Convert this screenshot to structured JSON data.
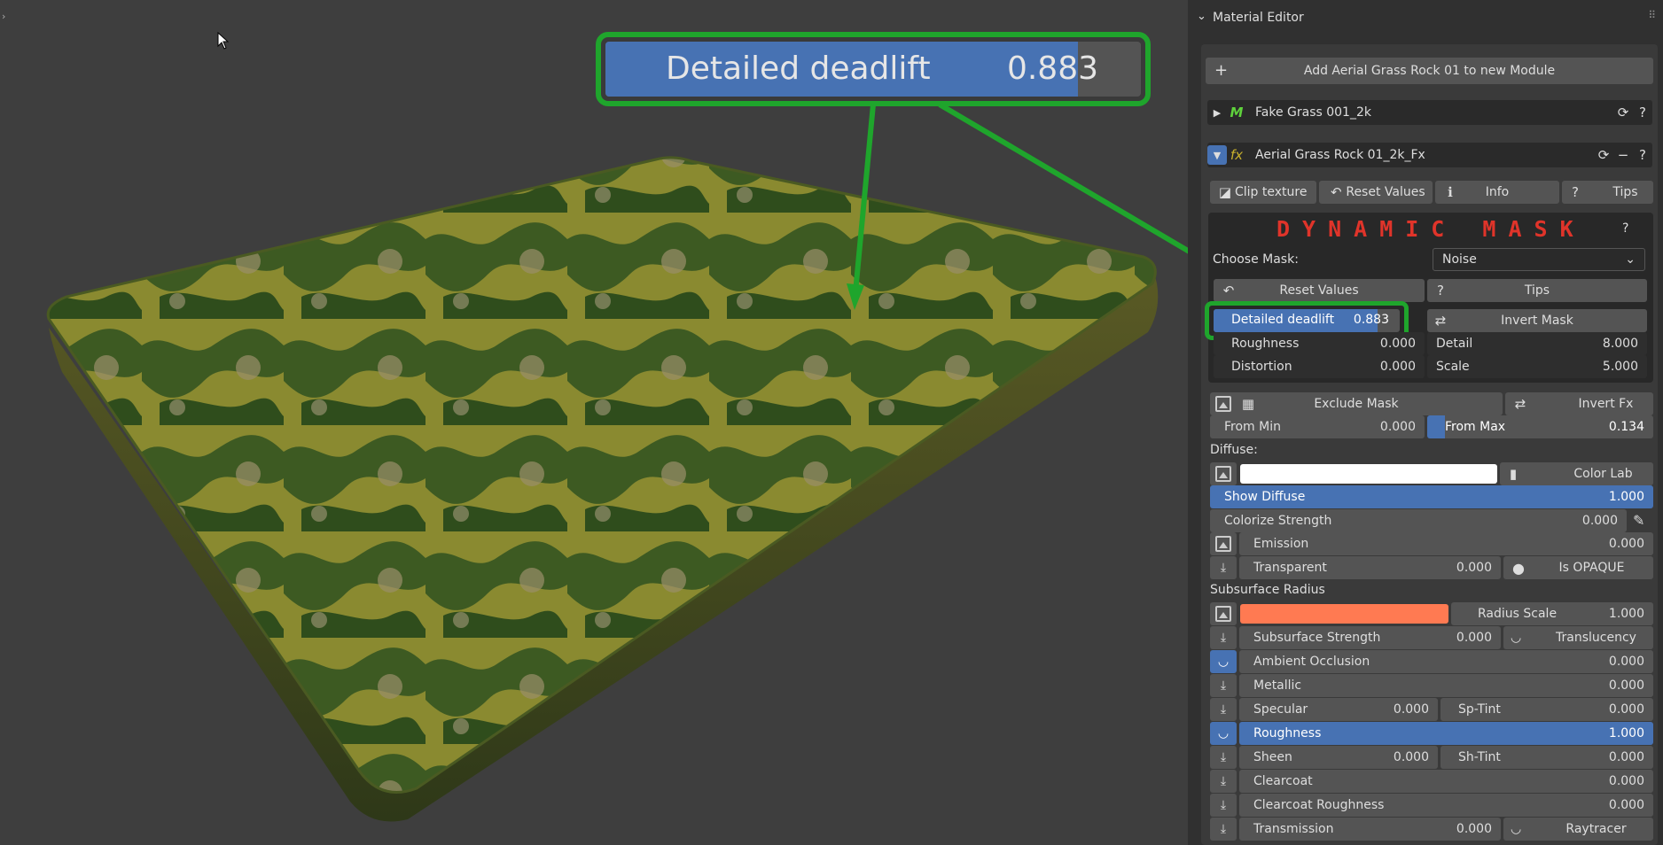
{
  "viewport": {
    "alt": "3D viewport showing a grass and rock textured slab"
  },
  "callout": {
    "label": "Detailed deadlift",
    "value": "0.883",
    "fill": 0.883,
    "border_color": "#1fa52c"
  },
  "panel": {
    "title": "Material Editor",
    "add_button": "Add Aerial Grass Rock 01 to new Module",
    "module1": "Fake Grass 001_2k",
    "module2": "Aerial Grass Rock 01_2k_Fx",
    "clip_texture": "Clip texture",
    "reset_values": "Reset Values",
    "info": "Info",
    "tips": "Tips",
    "dynamic_mask": "DYNAMIC MASK",
    "choose_mask_label": "Choose Mask:",
    "choose_mask_value": "Noise",
    "mask_reset": "Reset Values",
    "mask_tips": "Tips",
    "detailed_deadlift": {
      "label": "Detailed deadlift",
      "value": "0.883",
      "fill": 0.883
    },
    "invert_mask": "Invert Mask",
    "roughness": {
      "label": "Roughness",
      "value": "0.000"
    },
    "detail": {
      "label": "Detail",
      "value": "8.000"
    },
    "distortion": {
      "label": "Distortion",
      "value": "0.000"
    },
    "scale": {
      "label": "Scale",
      "value": "5.000"
    },
    "exclude_mask": "Exclude Mask",
    "invert_fx": "Invert Fx",
    "from_min": {
      "label": "From Min",
      "value": "0.000"
    },
    "from_max": {
      "label": "From Max",
      "value": "0.134"
    },
    "diffuse_heading": "Diffuse:",
    "color_lab": "Color Lab",
    "show_diffuse": {
      "label": "Show Diffuse",
      "value": "1.000"
    },
    "colorize_strength": {
      "label": "Colorize Strength",
      "value": "0.000"
    },
    "emission": {
      "label": "Emission",
      "value": "0.000"
    },
    "transparent": {
      "label": "Transparent",
      "value": "0.000"
    },
    "is_opaque": "Is OPAQUE",
    "subsurface_heading": "Subsurface Radius",
    "subsurface_color": "#ff7a52",
    "radius_scale": {
      "label": "Radius Scale",
      "value": "1.000"
    },
    "subsurface_strength": {
      "label": "Subsurface Strength",
      "value": "0.000"
    },
    "translucency": "Translucency",
    "ambient_occlusion": {
      "label": "Ambient Occlusion",
      "value": "0.000"
    },
    "metallic": {
      "label": "Metallic",
      "value": "0.000"
    },
    "specular": {
      "label": "Specular",
      "value": "0.000"
    },
    "sp_tint": {
      "label": "Sp-Tint",
      "value": "0.000"
    },
    "roughness2": {
      "label": "Roughness",
      "value": "1.000"
    },
    "sheen": {
      "label": "Sheen",
      "value": "0.000"
    },
    "sh_tint": {
      "label": "Sh-Tint",
      "value": "0.000"
    },
    "clearcoat": {
      "label": "Clearcoat",
      "value": "0.000"
    },
    "clearcoat_roughness": {
      "label": "Clearcoat Roughness",
      "value": "0.000"
    },
    "transmission": {
      "label": "Transmission",
      "value": "0.000"
    },
    "raytracer": "Raytracer"
  }
}
